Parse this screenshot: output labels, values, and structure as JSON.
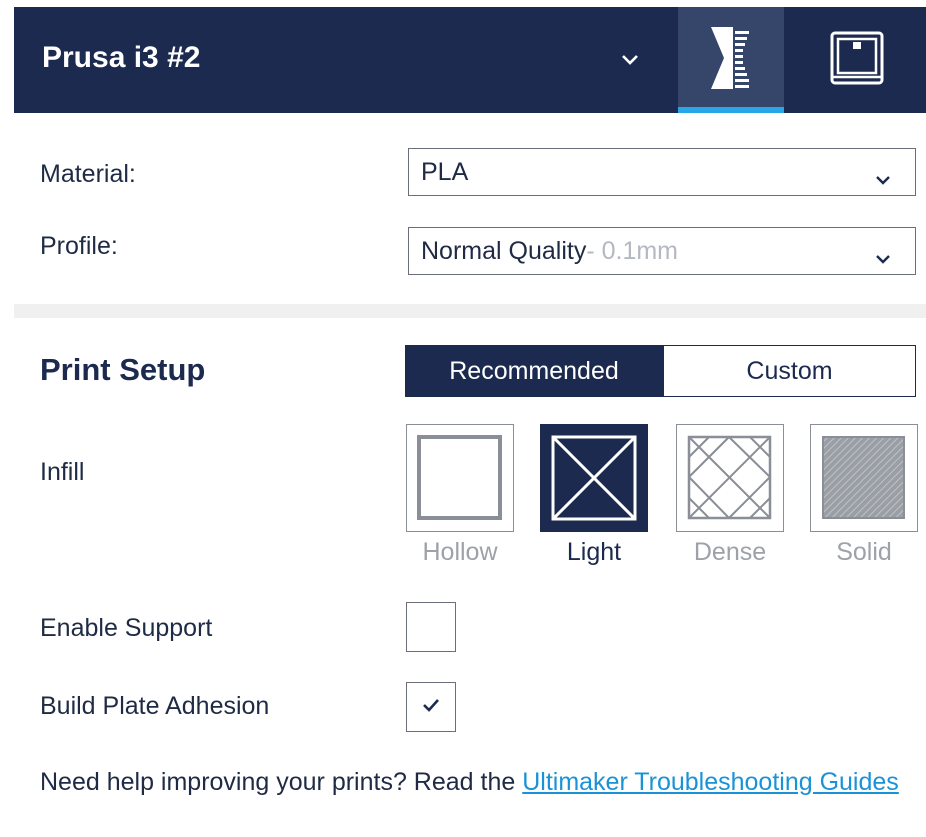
{
  "header": {
    "printer_name": "Prusa i3 #2",
    "accent_color": "#1b2a4e",
    "active_tab_indicator_color": "#29a6e6",
    "tabs": [
      {
        "icon": "print-settings-icon",
        "active": true
      },
      {
        "icon": "printer-monitor-icon",
        "active": false
      }
    ],
    "dropdown_icon": "chevron-down-icon"
  },
  "material": {
    "label": "Material:",
    "value": "PLA"
  },
  "profile": {
    "label": "Profile:",
    "value": "Normal Quality",
    "detail": " - 0.1mm"
  },
  "print_setup": {
    "title": "Print Setup",
    "modes": [
      "Recommended",
      "Custom"
    ],
    "selected_mode": "Recommended"
  },
  "infill": {
    "label": "Infill",
    "options": [
      {
        "label": "Hollow",
        "icon": "infill-hollow-icon"
      },
      {
        "label": "Light",
        "icon": "infill-light-icon"
      },
      {
        "label": "Dense",
        "icon": "infill-dense-icon"
      },
      {
        "label": "Solid",
        "icon": "infill-solid-icon"
      }
    ],
    "selected": "Light"
  },
  "support": {
    "label": "Enable Support",
    "checked": false
  },
  "adhesion": {
    "label": "Build Plate Adhesion",
    "checked": true
  },
  "help": {
    "text": "Need help improving your prints? Read the ",
    "link_text": "Ultimaker Troubleshooting Guides",
    "link_color": "#1a93d6"
  }
}
